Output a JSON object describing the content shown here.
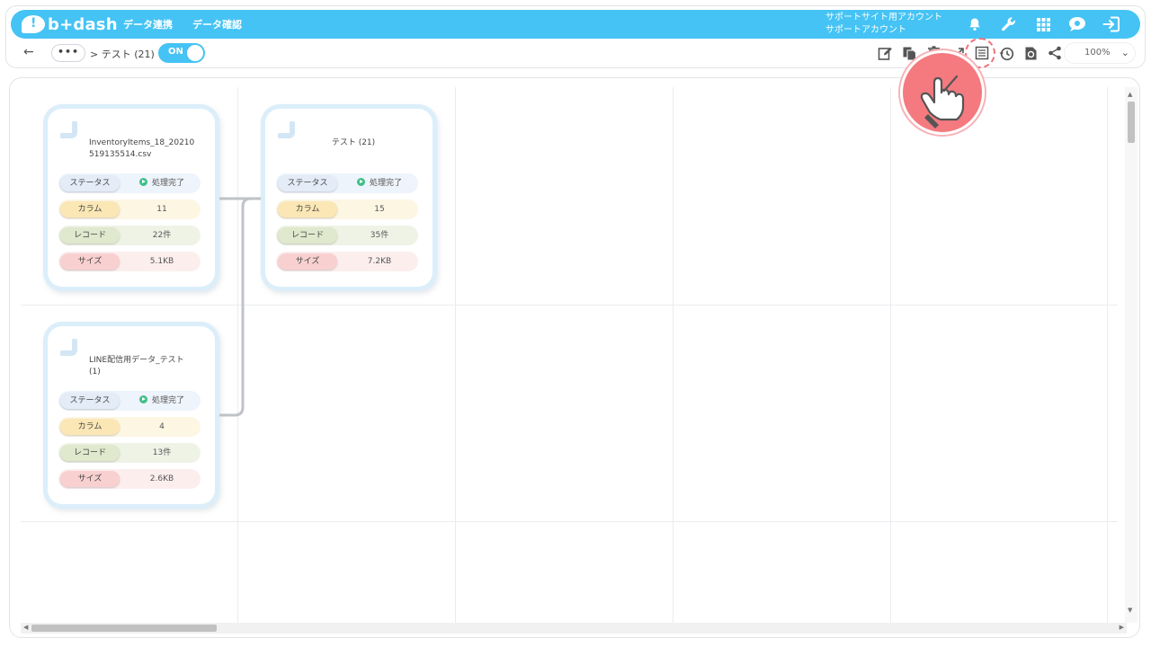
{
  "header": {
    "logo_text": "b+dash",
    "nav": [
      "データ連携",
      "データ確認"
    ],
    "account_line1": "サポートサイト用アカウント",
    "account_line2": "サポートアカウント",
    "icons": [
      "bell-icon",
      "wrench-icon",
      "grid-apps-icon",
      "chat-icon",
      "logout-icon"
    ]
  },
  "subbar": {
    "back": "←",
    "more": "•••",
    "breadcrumb": "> テスト (21)",
    "toggle_label": "ON",
    "tools": [
      "edit-icon",
      "copy-icon",
      "trash-icon",
      "export-icon",
      "list-icon",
      "history-icon",
      "refresh-file-icon",
      "share-icon"
    ],
    "zoom": "100%"
  },
  "nodes": [
    {
      "title": "InventoryItems_18_20210519135514.csv",
      "status_label": "ステータス",
      "status_value": "処理完了",
      "column_label": "カラム",
      "column_value": "11",
      "record_label": "レコード",
      "record_value": "22件",
      "size_label": "サイズ",
      "size_value": "5.1KB"
    },
    {
      "title": "テスト (21)",
      "status_label": "ステータス",
      "status_value": "処理完了",
      "column_label": "カラム",
      "column_value": "15",
      "record_label": "レコード",
      "record_value": "35件",
      "size_label": "サイズ",
      "size_value": "7.2KB"
    },
    {
      "title": "LINE配信用データ_テスト (1)",
      "status_label": "ステータス",
      "status_value": "処理完了",
      "column_label": "カラム",
      "column_value": "4",
      "record_label": "レコード",
      "record_value": "13件",
      "size_label": "サイズ",
      "size_value": "2.6KB"
    }
  ],
  "colors": {
    "brand": "#45c3f4",
    "status_ok": "#3fbf8a",
    "highlight": "#f47a80"
  }
}
